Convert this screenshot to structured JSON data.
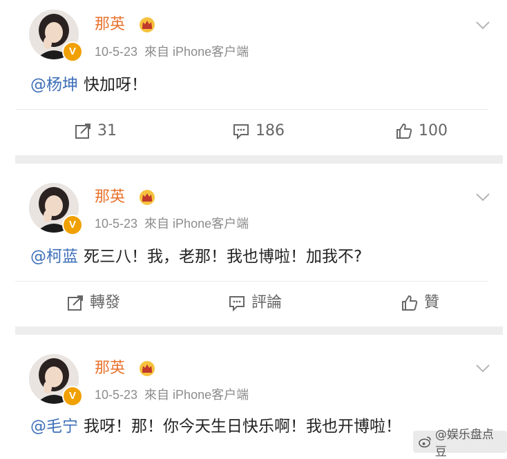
{
  "posts": [
    {
      "author": "那英",
      "date": "10-5-23",
      "source": "來自 iPhone客户端",
      "mention": "@杨坤",
      "text": "快加呀！",
      "actions": {
        "repost": "31",
        "comment": "186",
        "like": "100"
      }
    },
    {
      "author": "那英",
      "date": "10-5-23",
      "source": "來自 iPhone客户端",
      "mention": "@柯蓝",
      "text": "死三八！我，老那！我也博啦！加我不?",
      "actions": {
        "repost": "轉發",
        "comment": "評論",
        "like": "贊"
      }
    },
    {
      "author": "那英",
      "date": "10-5-23",
      "source": "來自 iPhone客户端",
      "mention": "@毛宁",
      "text": "我呀！那！你今天生日快乐啊！我也开博啦！"
    }
  ],
  "watermark": "@娱乐盘点豆",
  "colors": {
    "name": "#e8722c",
    "mention": "#3e6fb8",
    "badge": "#f0a000"
  },
  "icons": [
    "avatar",
    "verified-badge-icon",
    "crown-vip-icon",
    "chevron-down-icon",
    "repost-icon",
    "comment-icon",
    "like-icon",
    "weibo-logo-icon"
  ]
}
